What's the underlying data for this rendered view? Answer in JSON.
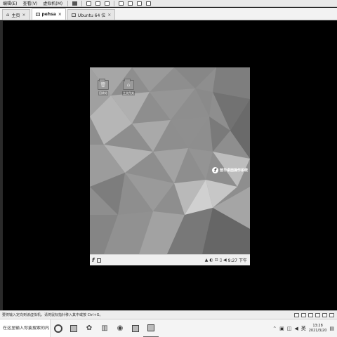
{
  "host_menu": {
    "items": [
      "编辑(E)",
      "查看(V)",
      "虚拟机(M)"
    ]
  },
  "tabs": [
    {
      "label": "主页",
      "icon": "home-icon",
      "close": "×"
    },
    {
      "label": "pehsa",
      "icon": "vm-icon",
      "close": "×"
    },
    {
      "label": "Ubuntu 64 位",
      "icon": "vm-icon",
      "close": "×"
    }
  ],
  "guest": {
    "desktop_icons": [
      {
        "label": "回收站",
        "icon": "trash-icon"
      },
      {
        "label": "主文件夹",
        "icon": "home-folder-icon"
      }
    ],
    "brand": {
      "logo": "f",
      "text": "普华桌面操作系统"
    },
    "taskbar": {
      "start_icon": "f",
      "time": "9:27 下午"
    }
  },
  "status_bar": {
    "text": "要将输入定向到该虚拟机，请将鼠标指针移入其中或按 Ctrl+G。"
  },
  "win_taskbar": {
    "search_placeholder": "在这里输入你要搜索的内容",
    "ime": "英",
    "clock_time": "13:28",
    "clock_date": "2021/3/20"
  },
  "colors": {
    "viewport_bg": "#000000",
    "guest_taskbar": "#efefef",
    "wallpaper_base": "#8e8e8e"
  }
}
